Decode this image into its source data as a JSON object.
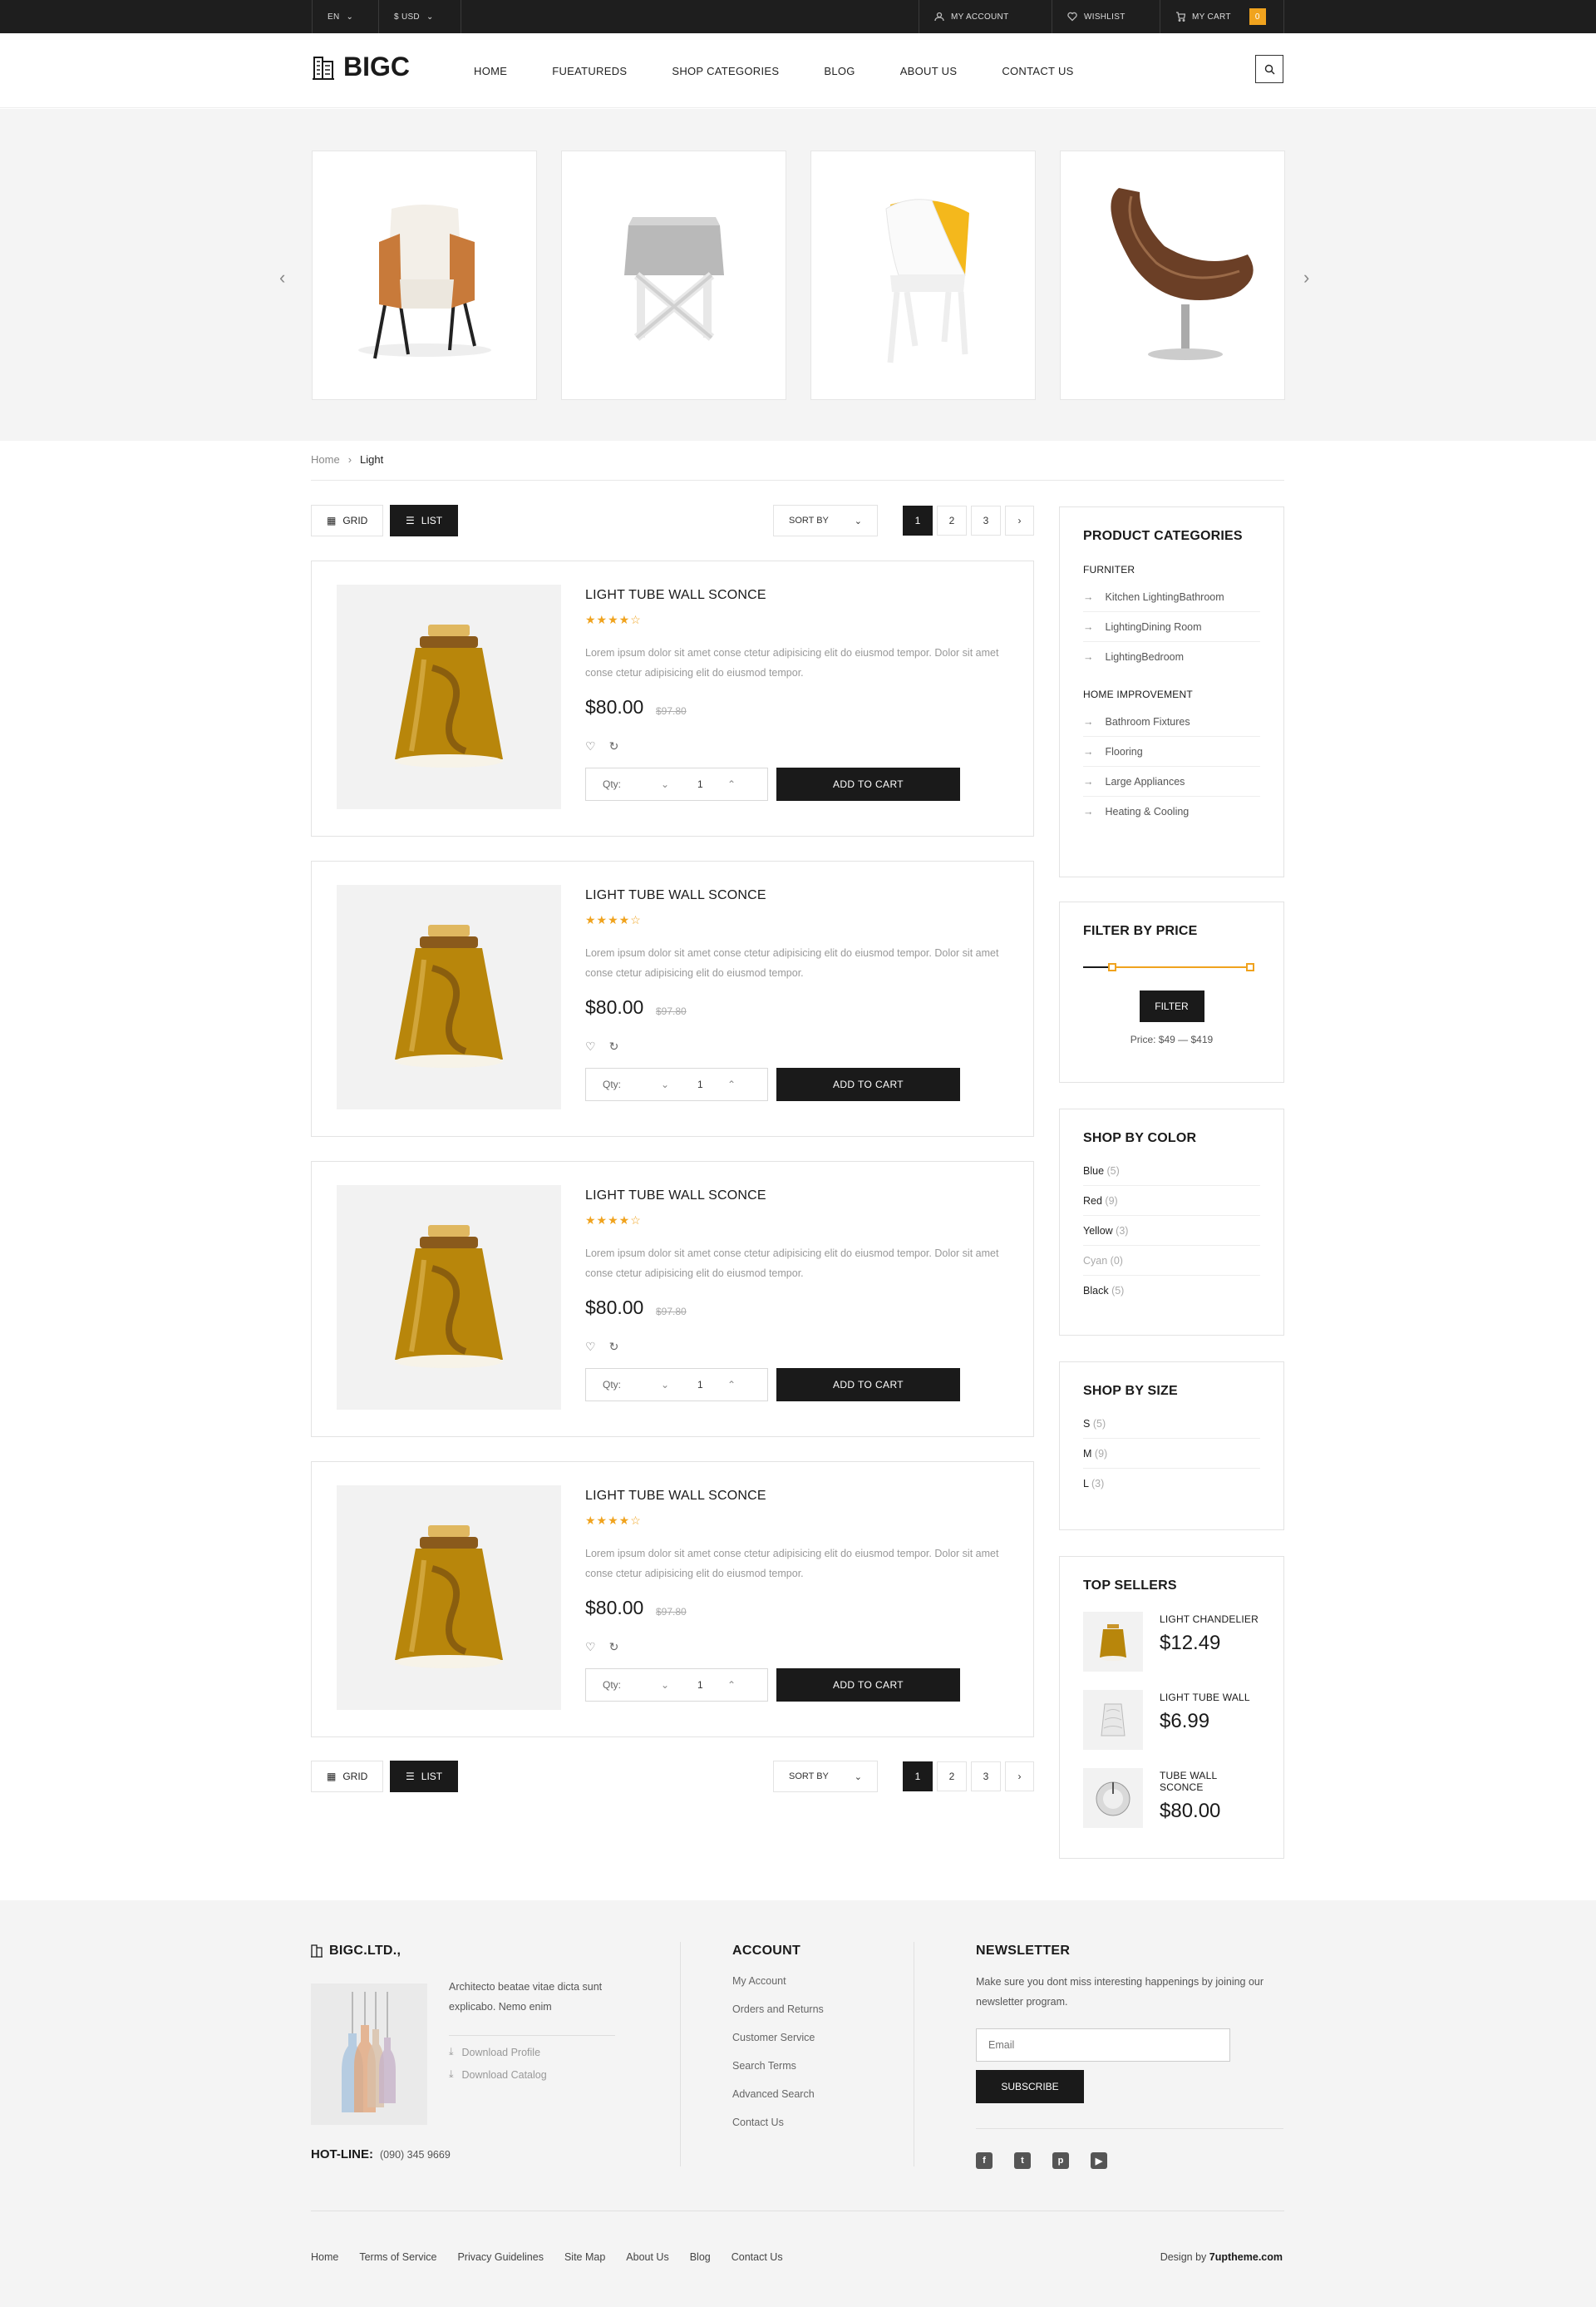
{
  "topbar": {
    "language": "EN",
    "currency": "$ USD",
    "account": "MY ACCOUNT",
    "wishlist": "WISHLIST",
    "cart": "MY CART",
    "cart_count": "0"
  },
  "header": {
    "logo": "BIGC",
    "nav": [
      "HOME",
      "FUEATUREDS",
      "SHOP CATEGORIES",
      "BLOG",
      "ABOUT US",
      "CONTACT US"
    ]
  },
  "banner": {
    "items": [
      "armchair",
      "x-stool",
      "yellow-chair",
      "lounge-chair"
    ]
  },
  "breadcrumb": {
    "home": "Home",
    "current": "Light"
  },
  "toolbar": {
    "grid": "GRID",
    "list": "LIST",
    "sort": "SORT BY",
    "pages": [
      "1",
      "2",
      "3"
    ]
  },
  "products": [
    {
      "title": "LIGHT TUBE WALL SCONCE",
      "stars": "★★★★☆",
      "desc": "Lorem ipsum dolor sit amet conse ctetur adipisicing elit do eiusmod tempor. Dolor sit amet conse ctetur adipisicing elit do eiusmod tempor.",
      "price": "$80.00",
      "old_price": "$97.80",
      "qty_label": "Qty:",
      "qty": "1",
      "cta": "ADD TO CART"
    },
    {
      "title": "LIGHT TUBE WALL SCONCE",
      "stars": "★★★★☆",
      "desc": "Lorem ipsum dolor sit amet conse ctetur adipisicing elit do eiusmod tempor. Dolor sit amet conse ctetur adipisicing elit do eiusmod tempor.",
      "price": "$80.00",
      "old_price": "$97.80",
      "qty_label": "Qty:",
      "qty": "1",
      "cta": "ADD TO CART"
    },
    {
      "title": "LIGHT TUBE WALL SCONCE",
      "stars": "★★★★☆",
      "desc": "Lorem ipsum dolor sit amet conse ctetur adipisicing elit do eiusmod tempor. Dolor sit amet conse ctetur adipisicing elit do eiusmod tempor.",
      "price": "$80.00",
      "old_price": "$97.80",
      "qty_label": "Qty:",
      "qty": "1",
      "cta": "ADD TO CART"
    },
    {
      "title": "LIGHT TUBE WALL SCONCE",
      "stars": "★★★★☆",
      "desc": "Lorem ipsum dolor sit amet conse ctetur adipisicing elit do eiusmod tempor. Dolor sit amet conse ctetur adipisicing elit do eiusmod tempor.",
      "price": "$80.00",
      "old_price": "$97.80",
      "qty_label": "Qty:",
      "qty": "1",
      "cta": "ADD TO CART"
    }
  ],
  "sidebar": {
    "categories": {
      "title": "PRODUCT CATEGORIES",
      "groups": [
        {
          "name": "FURNITER",
          "items": [
            "Kitchen LightingBathroom",
            "LightingDining Room",
            "LightingBedroom"
          ]
        },
        {
          "name": "HOME IMPROVEMENT",
          "items": [
            "Bathroom Fixtures",
            "Flooring",
            "Large Appliances",
            "Heating & Cooling"
          ]
        }
      ]
    },
    "price": {
      "title": "FILTER BY PRICE",
      "button": "FILTER",
      "range": "Price: $49 — $419",
      "low_fraction": 0.17,
      "high_fraction": 1.0
    },
    "colors": {
      "title": "SHOP BY COLOR",
      "items": [
        {
          "name": "Blue",
          "count": "(5)"
        },
        {
          "name": "Red",
          "count": "(9)"
        },
        {
          "name": "Yellow",
          "count": "(3)"
        },
        {
          "name": "Cyan",
          "count": "(0)"
        },
        {
          "name": "Black",
          "count": "(5)"
        }
      ]
    },
    "sizes": {
      "title": "SHOP BY SIZE",
      "items": [
        {
          "name": "S",
          "count": "(5)"
        },
        {
          "name": "M",
          "count": "(9)"
        },
        {
          "name": "L",
          "count": "(3)"
        }
      ]
    },
    "top_sellers": {
      "title": "TOP SELLERS",
      "items": [
        {
          "name": "LIGHT CHANDELIER",
          "price": "$12.49"
        },
        {
          "name": "LIGHT TUBE WALL",
          "price": "$6.99"
        },
        {
          "name": "TUBE WALL SCONCE",
          "price": "$80.00"
        }
      ]
    }
  },
  "footer": {
    "brand": "BIGC.LTD.,",
    "about": "Architecto beatae vitae dicta sunt explicabo. Nemo enim",
    "downloads": [
      "Download Profile",
      "Download Catalog"
    ],
    "hotline_label": "HOT-LINE:",
    "hotline": "(090) 345 9669",
    "account_title": "ACCOUNT",
    "account_links": [
      "My Account",
      "Orders and Returns",
      "Customer Service",
      "Search Terms",
      "Advanced Search",
      "Contact Us"
    ],
    "newsletter_title": "NEWSLETTER",
    "newsletter_text": "Make sure you dont miss interesting happenings by joining our newsletter program.",
    "email_placeholder": "Email",
    "subscribe": "SUBSCRIBE",
    "bottom_links": [
      "Home",
      "Terms of Service",
      "Privacy Guidelines",
      "Site Map",
      "About Us",
      "Blog",
      "Contact Us"
    ],
    "design_by": "Design by",
    "design_brand": "7uptheme.com"
  },
  "colors": {
    "accent": "#f0a31e",
    "dark": "#1a1a1a"
  }
}
